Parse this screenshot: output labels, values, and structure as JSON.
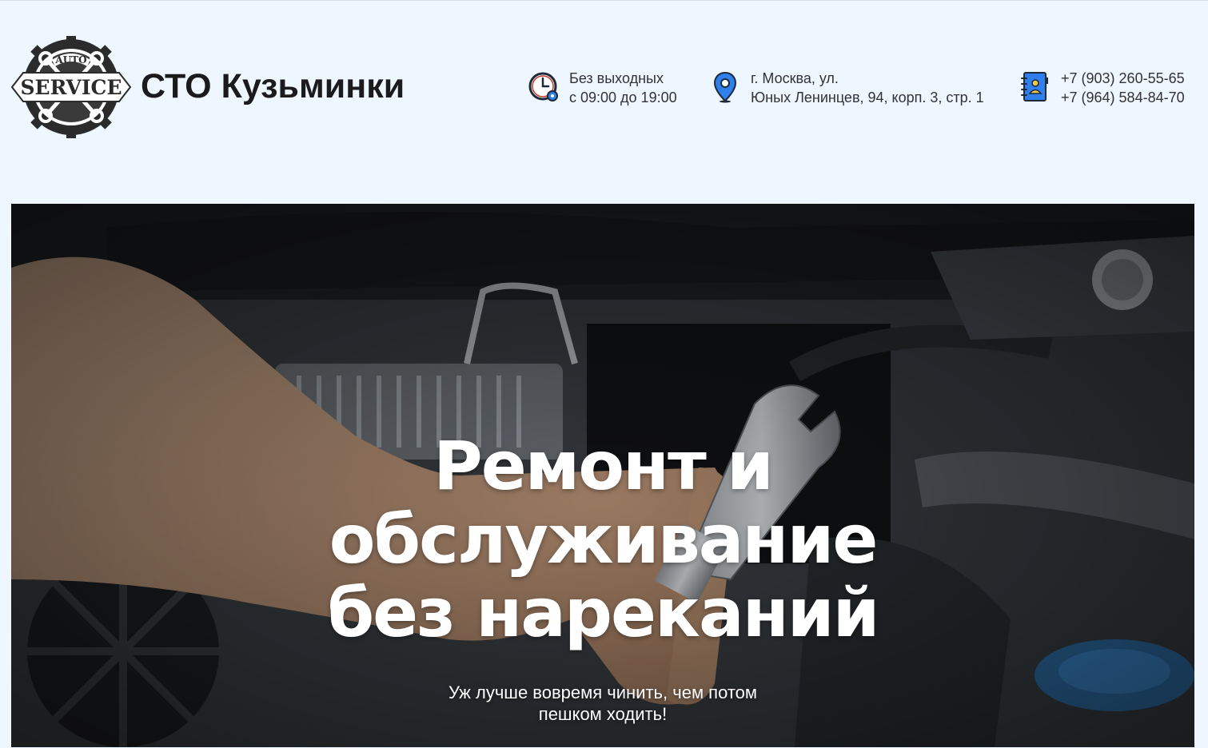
{
  "brand": {
    "logo": {
      "top_word": "AUTO",
      "main_word": "SERVICE"
    },
    "name": "СТО Кузьминки"
  },
  "contacts": {
    "hours": {
      "icon": "clock-gear-icon",
      "line1": "Без выходных",
      "line2": "с 09:00 до 19:00"
    },
    "address": {
      "icon": "map-pin-icon",
      "line1": "г. Москва, ул.",
      "line2": "Юных Ленинцев, 94, корп. 3, стр. 1"
    },
    "phones": {
      "icon": "address-book-icon",
      "line1": "+7 (903) 260-55-65",
      "line2": "+7 (964) 584-84-70"
    }
  },
  "hero": {
    "title_line1": "Ремонт и",
    "title_line2": "обслуживание",
    "title_line3": "без нареканий",
    "subtitle_line1": "Уж лучше вовремя чинить, чем потом",
    "subtitle_line2": "пешком ходить!"
  },
  "colors": {
    "page_bg": "#eef6ff",
    "accent_blue": "#2f80ed",
    "icon_dark": "#1d2a3a"
  }
}
